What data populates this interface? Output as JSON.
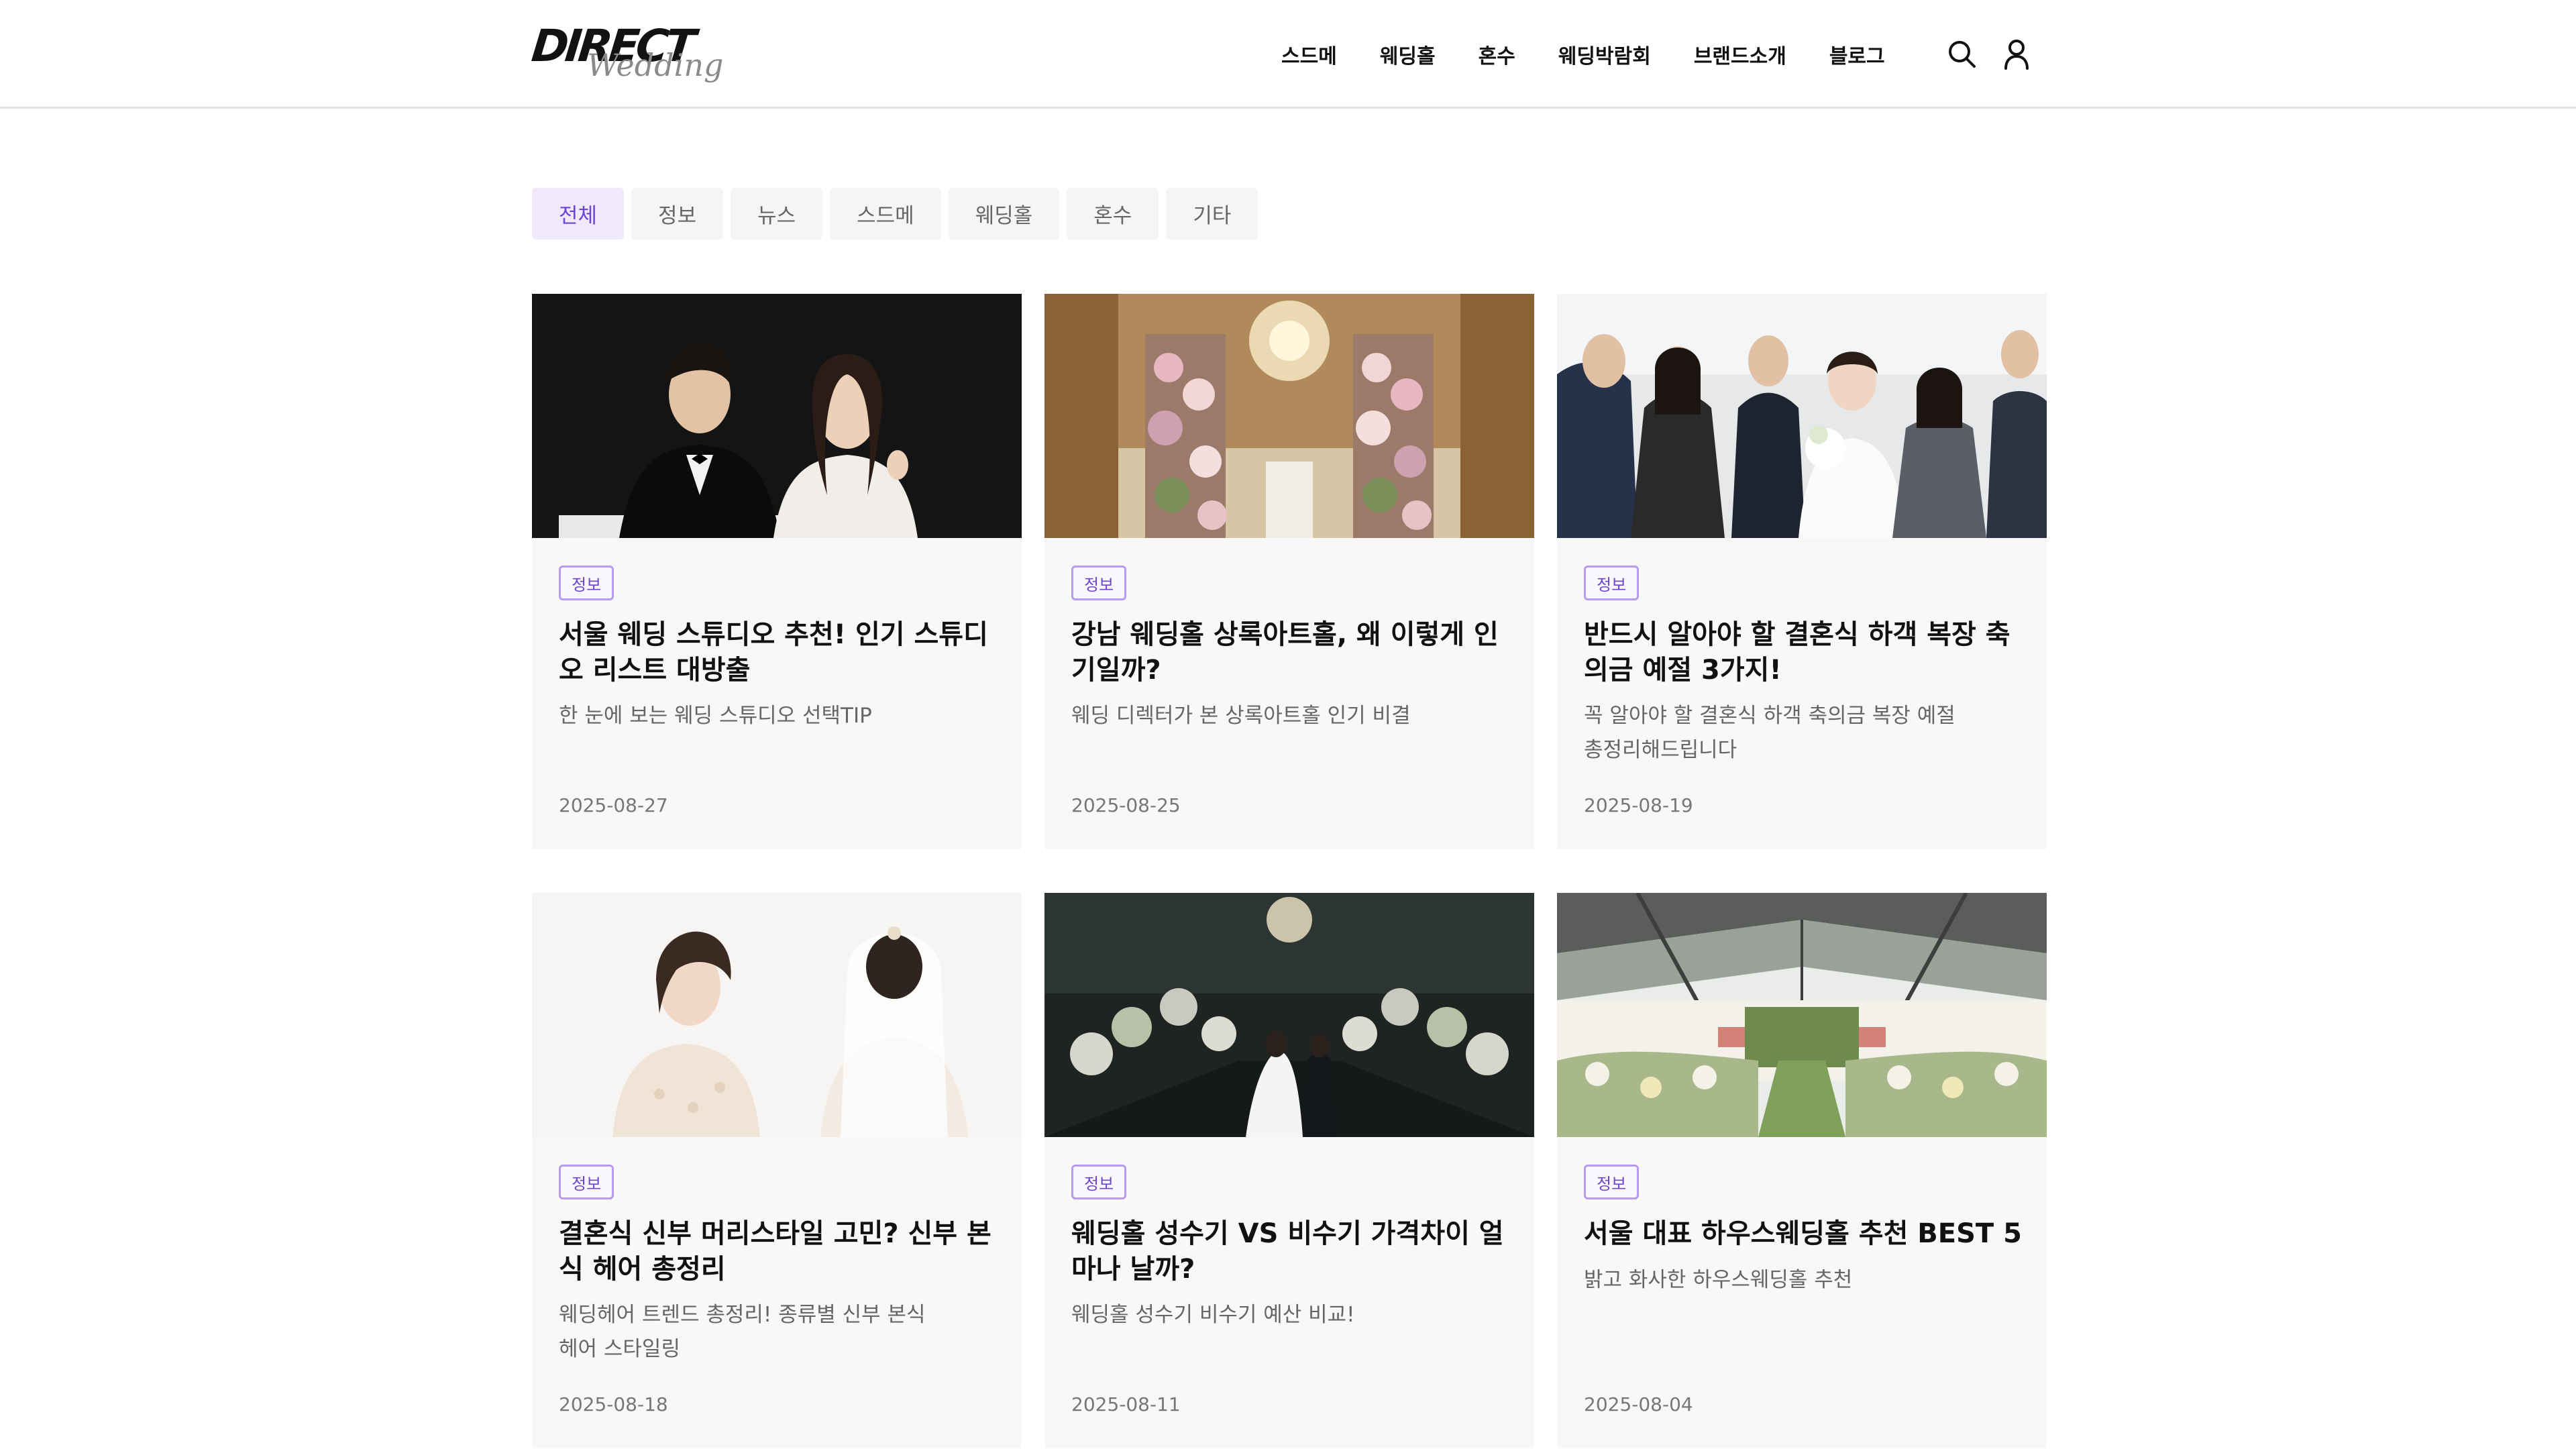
{
  "brand": {
    "logo_main": "DIRECT",
    "logo_script": "Wedding"
  },
  "nav": [
    "스드메",
    "웨딩홀",
    "혼수",
    "웨딩박람회",
    "브랜드소개",
    "블로그"
  ],
  "header_icons": [
    "search-icon",
    "user-icon"
  ],
  "filters": {
    "active": "전체",
    "items": [
      "전체",
      "정보",
      "뉴스",
      "스드메",
      "웨딩홀",
      "혼수",
      "기타"
    ]
  },
  "colors": {
    "accent": "#6d44d1",
    "accent_bg": "#efe9fb",
    "card_bg": "#f8f8f8"
  },
  "posts": [
    {
      "category": "정보",
      "title": "서울 웨딩 스튜디오 추천! 인기 스튜디오 리스트 대방출",
      "desc": "한 눈에 보는 웨딩 스튜디오 선택TIP",
      "date": "2025-08-27"
    },
    {
      "category": "정보",
      "title": "강남 웨딩홀 상록아트홀, 왜 이렇게 인기일까?",
      "desc": "웨딩 디렉터가 본 상록아트홀 인기 비결",
      "date": "2025-08-25"
    },
    {
      "category": "정보",
      "title": "반드시 알아야 할 결혼식 하객 복장 축의금 예절 3가지!",
      "desc": "꼭 알아야 할 결혼식 하객 축의금 복장 예절 총정리해드립니다",
      "date": "2025-08-19"
    },
    {
      "category": "정보",
      "title": "결혼식 신부 머리스타일 고민? 신부 본식 헤어 총정리",
      "desc": "웨딩헤어 트렌드 총정리! 종류별 신부 본식 헤어 스타일링",
      "date": "2025-08-18"
    },
    {
      "category": "정보",
      "title": "웨딩홀 성수기 VS 비수기 가격차이 얼마나 날까?",
      "desc": "웨딩홀 성수기 비수기 예산 비교!",
      "date": "2025-08-11"
    },
    {
      "category": "정보",
      "title": "서울 대표 하우스웨딩홀 추천 BEST 5",
      "desc": "밝고 화사한 하우스웨딩홀 추천",
      "date": "2025-08-04"
    }
  ]
}
